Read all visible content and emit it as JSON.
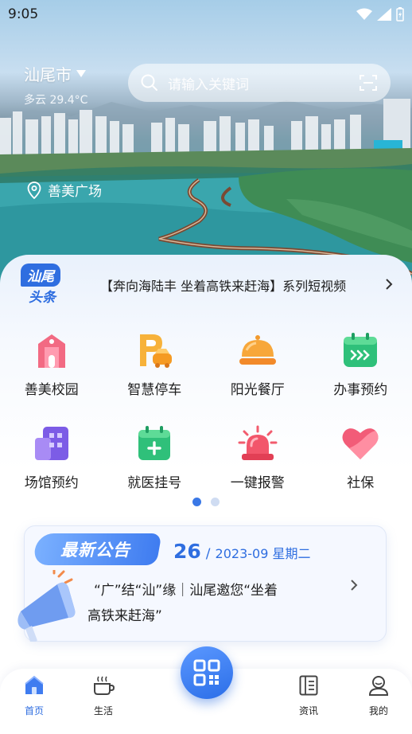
{
  "status_bar": {
    "time": "9:05"
  },
  "header": {
    "city": "汕尾市",
    "weather_condition": "多云",
    "temperature": "29.4°C",
    "search_placeholder": "请输入关键词",
    "location": "善美广场"
  },
  "ticker": {
    "badge_top": "汕尾",
    "badge_bottom": "头条",
    "headline": "【奔向海陆丰 坐着高铁来赶海】系列短视频"
  },
  "services": [
    {
      "label": "善美校园",
      "icon": "campus-icon"
    },
    {
      "label": "智慧停车",
      "icon": "parking-icon"
    },
    {
      "label": "阳光餐厅",
      "icon": "restaurant-icon"
    },
    {
      "label": "办事预约",
      "icon": "appointment-icon"
    },
    {
      "label": "场馆预约",
      "icon": "venue-icon"
    },
    {
      "label": "就医挂号",
      "icon": "medical-icon"
    },
    {
      "label": "一键报警",
      "icon": "alarm-icon"
    },
    {
      "label": "社保",
      "icon": "heart-icon"
    }
  ],
  "pager": {
    "pages": 2,
    "active": 1
  },
  "announcement": {
    "tag": "最新公告",
    "day": "26",
    "month": "2023-09 星期二",
    "line1": "“广”结“汕”缘｜汕尾邀您“坐着",
    "line2": "高铁来赶海”"
  },
  "bottom_nav": [
    {
      "label": "首页",
      "active": true,
      "icon": "home-icon"
    },
    {
      "label": "生活",
      "active": false,
      "icon": "cup-icon"
    },
    {
      "label": "资讯",
      "active": false,
      "icon": "news-icon"
    },
    {
      "label": "我的",
      "active": false,
      "icon": "profile-icon"
    }
  ],
  "colors": {
    "accent": "#2f6ee0",
    "badge": "#2f6ee0"
  }
}
